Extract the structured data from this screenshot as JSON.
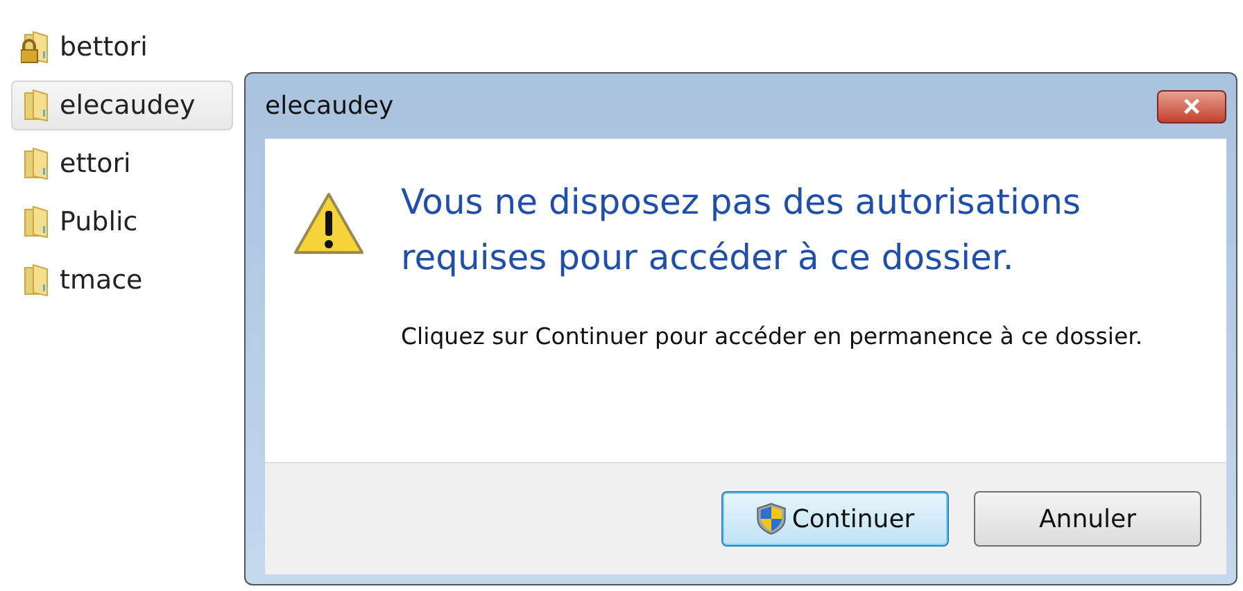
{
  "folders": [
    {
      "name": "bettori",
      "kind": "locked",
      "selected": false
    },
    {
      "name": "elecaudey",
      "kind": "folder",
      "selected": true
    },
    {
      "name": "ettori",
      "kind": "folder",
      "selected": false
    },
    {
      "name": "Public",
      "kind": "folder",
      "selected": false
    },
    {
      "name": "tmace",
      "kind": "folder",
      "selected": false
    }
  ],
  "dialog": {
    "title": "elecaudey",
    "close": "×",
    "heading": "Vous ne disposez pas des autorisations requises pour accéder à ce dossier.",
    "message": "Cliquez sur Continuer pour accéder en permanence à ce dossier.",
    "buttons": [
      {
        "label": "Continuer",
        "kind": "shield",
        "default": true
      },
      {
        "label": "Annuler",
        "kind": "plain",
        "default": false
      }
    ]
  }
}
